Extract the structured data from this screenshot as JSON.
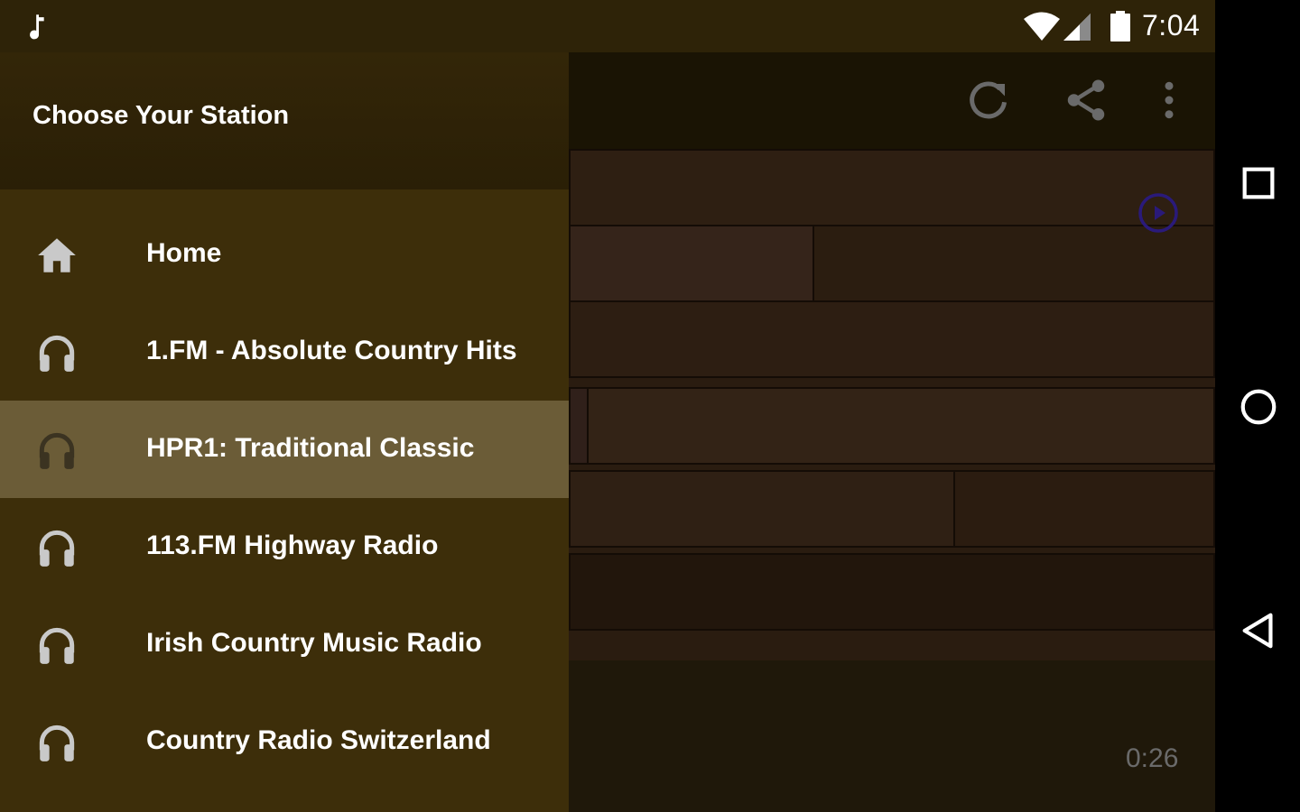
{
  "status_bar": {
    "time": "7:04",
    "icons": [
      "music-note-icon",
      "wifi-icon",
      "cell-signal-icon",
      "battery-icon"
    ]
  },
  "drawer": {
    "title": "Choose Your Station",
    "items": [
      {
        "label": "Home",
        "icon": "home-icon",
        "selected": false
      },
      {
        "label": "1.FM - Absolute Country Hits",
        "icon": "headphones-icon",
        "selected": false
      },
      {
        "label": "HPR1: Traditional Classic",
        "icon": "headphones-icon",
        "selected": true
      },
      {
        "label": "113.FM Highway Radio",
        "icon": "headphones-icon",
        "selected": false
      },
      {
        "label": "Irish Country Music Radio",
        "icon": "headphones-icon",
        "selected": false
      },
      {
        "label": "Country Radio Switzerland",
        "icon": "headphones-icon",
        "selected": false
      }
    ]
  },
  "app_bar": {
    "actions": [
      "refresh-icon",
      "share-icon",
      "more-vert-icon"
    ]
  },
  "player": {
    "elapsed": "0:26"
  },
  "colors": {
    "drawer_bg": "#3d2e0a",
    "selected_bg": "#6b5c37",
    "status_bar_bg": "#2e2308",
    "play_accent": "#2a1a7a"
  },
  "nav_bar": {
    "buttons": [
      "recents-icon",
      "home-circle-icon",
      "back-icon"
    ]
  }
}
